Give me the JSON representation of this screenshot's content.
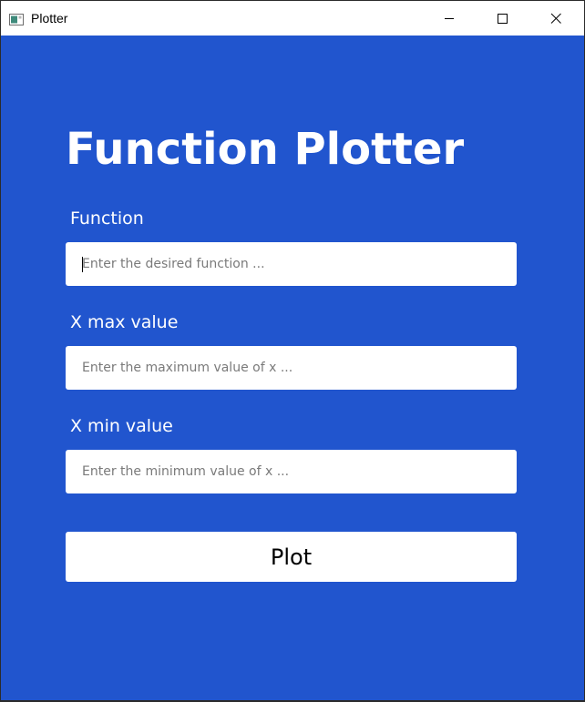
{
  "window": {
    "title": "Plotter",
    "controls": {
      "minimize_icon": "minimize-icon",
      "maximize_icon": "maximize-icon",
      "close_icon": "close-icon"
    }
  },
  "main": {
    "heading": "Function Plotter",
    "fields": [
      {
        "label": "Function",
        "value": "",
        "placeholder": "Enter the desired function ..."
      },
      {
        "label": "X max value",
        "value": "",
        "placeholder": "Enter the maximum value of x ..."
      },
      {
        "label": "X min value",
        "value": "",
        "placeholder": "Enter the minimum value of x ..."
      }
    ],
    "plot_button": "Plot"
  },
  "colors": {
    "background": "#2155ce",
    "text": "#ffffff",
    "field_background": "#ffffff"
  }
}
